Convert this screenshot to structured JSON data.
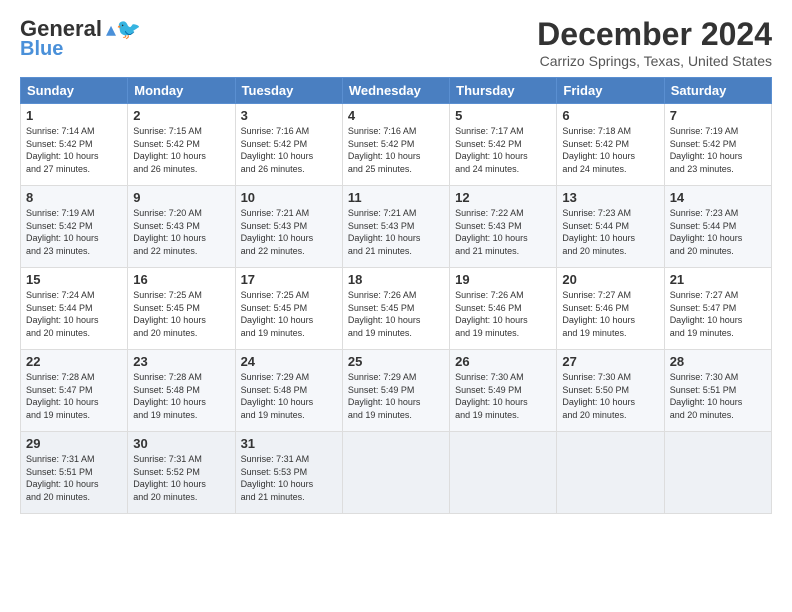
{
  "logo": {
    "line1": "General",
    "line2": "Blue"
  },
  "title": "December 2024",
  "location": "Carrizo Springs, Texas, United States",
  "days_of_week": [
    "Sunday",
    "Monday",
    "Tuesday",
    "Wednesday",
    "Thursday",
    "Friday",
    "Saturday"
  ],
  "weeks": [
    [
      {
        "day": "1",
        "info": "Sunrise: 7:14 AM\nSunset: 5:42 PM\nDaylight: 10 hours\nand 27 minutes."
      },
      {
        "day": "2",
        "info": "Sunrise: 7:15 AM\nSunset: 5:42 PM\nDaylight: 10 hours\nand 26 minutes."
      },
      {
        "day": "3",
        "info": "Sunrise: 7:16 AM\nSunset: 5:42 PM\nDaylight: 10 hours\nand 26 minutes."
      },
      {
        "day": "4",
        "info": "Sunrise: 7:16 AM\nSunset: 5:42 PM\nDaylight: 10 hours\nand 25 minutes."
      },
      {
        "day": "5",
        "info": "Sunrise: 7:17 AM\nSunset: 5:42 PM\nDaylight: 10 hours\nand 24 minutes."
      },
      {
        "day": "6",
        "info": "Sunrise: 7:18 AM\nSunset: 5:42 PM\nDaylight: 10 hours\nand 24 minutes."
      },
      {
        "day": "7",
        "info": "Sunrise: 7:19 AM\nSunset: 5:42 PM\nDaylight: 10 hours\nand 23 minutes."
      }
    ],
    [
      {
        "day": "8",
        "info": "Sunrise: 7:19 AM\nSunset: 5:42 PM\nDaylight: 10 hours\nand 23 minutes."
      },
      {
        "day": "9",
        "info": "Sunrise: 7:20 AM\nSunset: 5:43 PM\nDaylight: 10 hours\nand 22 minutes."
      },
      {
        "day": "10",
        "info": "Sunrise: 7:21 AM\nSunset: 5:43 PM\nDaylight: 10 hours\nand 22 minutes."
      },
      {
        "day": "11",
        "info": "Sunrise: 7:21 AM\nSunset: 5:43 PM\nDaylight: 10 hours\nand 21 minutes."
      },
      {
        "day": "12",
        "info": "Sunrise: 7:22 AM\nSunset: 5:43 PM\nDaylight: 10 hours\nand 21 minutes."
      },
      {
        "day": "13",
        "info": "Sunrise: 7:23 AM\nSunset: 5:44 PM\nDaylight: 10 hours\nand 20 minutes."
      },
      {
        "day": "14",
        "info": "Sunrise: 7:23 AM\nSunset: 5:44 PM\nDaylight: 10 hours\nand 20 minutes."
      }
    ],
    [
      {
        "day": "15",
        "info": "Sunrise: 7:24 AM\nSunset: 5:44 PM\nDaylight: 10 hours\nand 20 minutes."
      },
      {
        "day": "16",
        "info": "Sunrise: 7:25 AM\nSunset: 5:45 PM\nDaylight: 10 hours\nand 20 minutes."
      },
      {
        "day": "17",
        "info": "Sunrise: 7:25 AM\nSunset: 5:45 PM\nDaylight: 10 hours\nand 19 minutes."
      },
      {
        "day": "18",
        "info": "Sunrise: 7:26 AM\nSunset: 5:45 PM\nDaylight: 10 hours\nand 19 minutes."
      },
      {
        "day": "19",
        "info": "Sunrise: 7:26 AM\nSunset: 5:46 PM\nDaylight: 10 hours\nand 19 minutes."
      },
      {
        "day": "20",
        "info": "Sunrise: 7:27 AM\nSunset: 5:46 PM\nDaylight: 10 hours\nand 19 minutes."
      },
      {
        "day": "21",
        "info": "Sunrise: 7:27 AM\nSunset: 5:47 PM\nDaylight: 10 hours\nand 19 minutes."
      }
    ],
    [
      {
        "day": "22",
        "info": "Sunrise: 7:28 AM\nSunset: 5:47 PM\nDaylight: 10 hours\nand 19 minutes."
      },
      {
        "day": "23",
        "info": "Sunrise: 7:28 AM\nSunset: 5:48 PM\nDaylight: 10 hours\nand 19 minutes."
      },
      {
        "day": "24",
        "info": "Sunrise: 7:29 AM\nSunset: 5:48 PM\nDaylight: 10 hours\nand 19 minutes."
      },
      {
        "day": "25",
        "info": "Sunrise: 7:29 AM\nSunset: 5:49 PM\nDaylight: 10 hours\nand 19 minutes."
      },
      {
        "day": "26",
        "info": "Sunrise: 7:30 AM\nSunset: 5:49 PM\nDaylight: 10 hours\nand 19 minutes."
      },
      {
        "day": "27",
        "info": "Sunrise: 7:30 AM\nSunset: 5:50 PM\nDaylight: 10 hours\nand 20 minutes."
      },
      {
        "day": "28",
        "info": "Sunrise: 7:30 AM\nSunset: 5:51 PM\nDaylight: 10 hours\nand 20 minutes."
      }
    ],
    [
      {
        "day": "29",
        "info": "Sunrise: 7:31 AM\nSunset: 5:51 PM\nDaylight: 10 hours\nand 20 minutes."
      },
      {
        "day": "30",
        "info": "Sunrise: 7:31 AM\nSunset: 5:52 PM\nDaylight: 10 hours\nand 20 minutes."
      },
      {
        "day": "31",
        "info": "Sunrise: 7:31 AM\nSunset: 5:53 PM\nDaylight: 10 hours\nand 21 minutes."
      },
      {
        "day": "",
        "info": ""
      },
      {
        "day": "",
        "info": ""
      },
      {
        "day": "",
        "info": ""
      },
      {
        "day": "",
        "info": ""
      }
    ]
  ]
}
